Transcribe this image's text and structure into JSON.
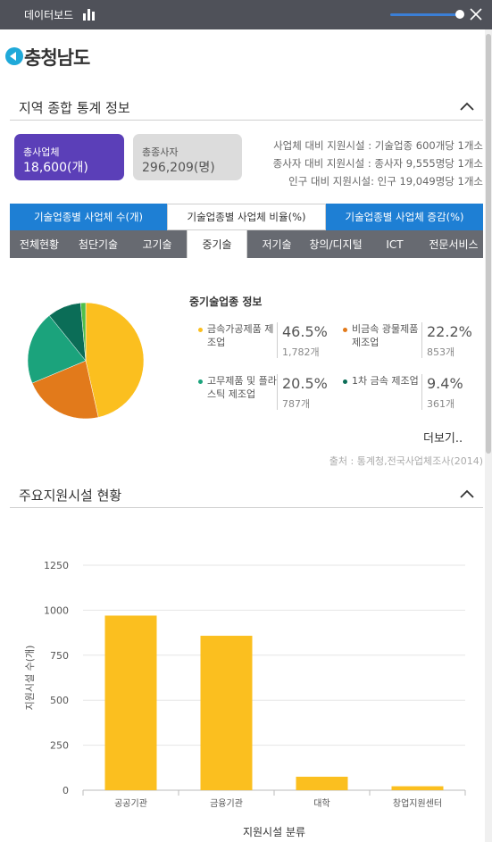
{
  "app": {
    "title": "데이터보드",
    "chart_icon": "bar-chart-icon",
    "close_icon": "close-icon"
  },
  "region": {
    "name": "충청남도"
  },
  "section1": {
    "title": "지역 종합 통계 정보"
  },
  "cards": {
    "companies": {
      "label": "총사업체",
      "value": "18,600(개)",
      "color": "#5b3fb8"
    },
    "employees": {
      "label": "총종사자",
      "value": "296,209(명)",
      "color": "#dcdcdc"
    }
  },
  "ratios": [
    "사업체 대비 지원시설 : 기술업종 600개당 1개소",
    "종사자 대비 지원시설 : 종사자 9,555명당 1개소",
    "인구 대비 지원시설: 인구 19,049명당 1개소"
  ],
  "tabs_primary": [
    {
      "label": "기술업종별 사업체 수(개)",
      "active": false
    },
    {
      "label": "기술업종별 사업체 비율(%)",
      "active": true
    },
    {
      "label": "기술업종별 사업체 증감(%)",
      "active": false
    }
  ],
  "tabs_secondary": [
    {
      "label": "전체현황",
      "active": false
    },
    {
      "label": "첨단기술",
      "active": false
    },
    {
      "label": "고기술",
      "active": false
    },
    {
      "label": "중기술",
      "active": true
    },
    {
      "label": "저기술",
      "active": false
    },
    {
      "label": "창의/디지털",
      "active": false
    },
    {
      "label": "ICT",
      "active": false
    },
    {
      "label": "전문서비스",
      "active": false
    }
  ],
  "info": {
    "title": "중기술업종 정보",
    "more": "더보기..",
    "source": "출처 : 통계청,전국사업체조사(2014)",
    "items": [
      {
        "name": "금속가공제품 제조업",
        "pct": "46.5%",
        "count": "1,782개",
        "color": "#fbbf1f"
      },
      {
        "name": "비금속 광물제품 제조업",
        "pct": "22.2%",
        "count": "853개",
        "color": "#e27a1b"
      },
      {
        "name": "고무제품 및 플라스틱 제조업",
        "pct": "20.5%",
        "count": "787개",
        "color": "#1ba37c"
      },
      {
        "name": "1차 금속 제조업",
        "pct": "9.4%",
        "count": "361개",
        "color": "#0b6d57"
      }
    ]
  },
  "pie_data": {
    "type": "pie",
    "slices": [
      {
        "value": 46.5,
        "color": "#fbbf1f"
      },
      {
        "value": 22.2,
        "color": "#e27a1b"
      },
      {
        "value": 20.5,
        "color": "#1ba37c"
      },
      {
        "value": 9.4,
        "color": "#0b6d57"
      },
      {
        "value": 1.4,
        "color": "#4fbf4a"
      }
    ]
  },
  "section2": {
    "title": "주요지원시설 현황"
  },
  "chart_data": {
    "type": "bar",
    "categories": [
      "공공기관",
      "금융기관",
      "대학",
      "창업지원센터"
    ],
    "values": [
      970,
      858,
      75,
      22
    ],
    "xlabel": "지원시설 분류",
    "ylabel": "지원시설 수(개)",
    "ylim": [
      0,
      1250
    ],
    "yticks": [
      0,
      250,
      500,
      750,
      1000,
      1250
    ],
    "bar_color": "#fbbf1f",
    "grid": true
  }
}
